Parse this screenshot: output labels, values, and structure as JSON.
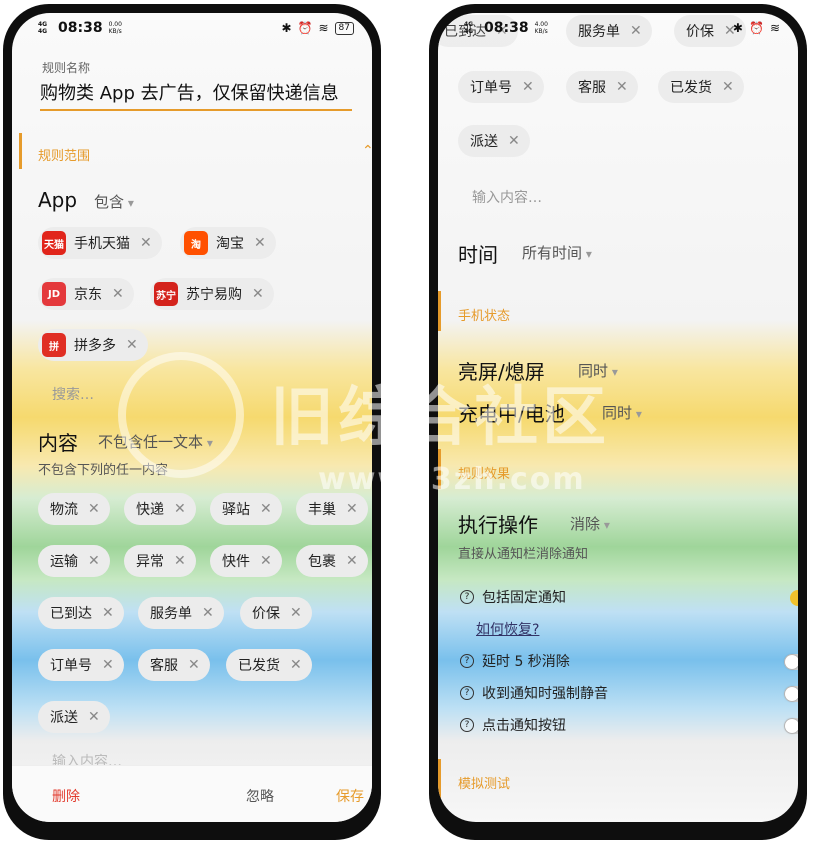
{
  "status_left": {
    "signal": "4G\n4G",
    "time": "08:38",
    "net": "0.00\nKB/s",
    "battery": "87"
  },
  "status_right": {
    "signal": "4G\n4G",
    "time": "08:38",
    "net": "4.00\nKB/s"
  },
  "rule_name": {
    "label": "规则名称",
    "value": "购物类 App 去广告，仅保留快递信息"
  },
  "rule_scope": {
    "title": "规则范围",
    "app_label": "App",
    "app_mode": "包含",
    "apps": [
      {
        "name": "手机天猫",
        "icon": "tmall-icon",
        "icon_text": "天猫",
        "color": "#e1251b"
      },
      {
        "name": "淘宝",
        "icon": "taobao-icon",
        "icon_text": "淘",
        "color": "#ff5000"
      },
      {
        "name": "京东",
        "icon": "jd-icon",
        "icon_text": "JD",
        "color": "#e4393c"
      },
      {
        "name": "苏宁易购",
        "icon": "suning-icon",
        "icon_text": "苏宁",
        "color": "#d4231c"
      },
      {
        "name": "拼多多",
        "icon": "pinduoduo-icon",
        "icon_text": "拼",
        "color": "#e02e24"
      }
    ],
    "search_placeholder": "搜索…",
    "content_label": "内容",
    "content_mode": "不包含任一文本",
    "content_desc": "不包含下列的任一内容",
    "keywords": [
      "物流",
      "快递",
      "驿站",
      "丰巢",
      "运输",
      "异常",
      "快件",
      "包裹",
      "已到达",
      "服务单",
      "价保",
      "订单号",
      "客服",
      "已发货",
      "派送"
    ],
    "input_placeholder": "输入内容…"
  },
  "footer": {
    "delete": "删除",
    "ignore": "忽略",
    "save": "保存"
  },
  "right": {
    "top_keywords": [
      "已到达",
      "服务单",
      "价保"
    ],
    "time_label": "时间",
    "time_mode": "所有时间",
    "phone_state_title": "手机状态",
    "screen_label": "亮屏/熄屏",
    "screen_mode": "同时",
    "charge_label": "充电中/电池",
    "charge_mode": "同时",
    "effect_title": "规则效果",
    "action_label": "执行操作",
    "action_mode": "消除",
    "action_desc": "直接从通知栏消除通知",
    "options": [
      {
        "label": "包括固定通知",
        "on": true
      },
      {
        "label": "延时 5 秒消除",
        "on": false
      },
      {
        "label": "收到通知时强制静音",
        "on": false
      },
      {
        "label": "点击通知按钮",
        "on": false
      }
    ],
    "how_restore": "如何恢复?",
    "test_title": "模拟测试"
  },
  "watermark": {
    "text": "旧综合社区",
    "url": "www.i3zh.com"
  }
}
